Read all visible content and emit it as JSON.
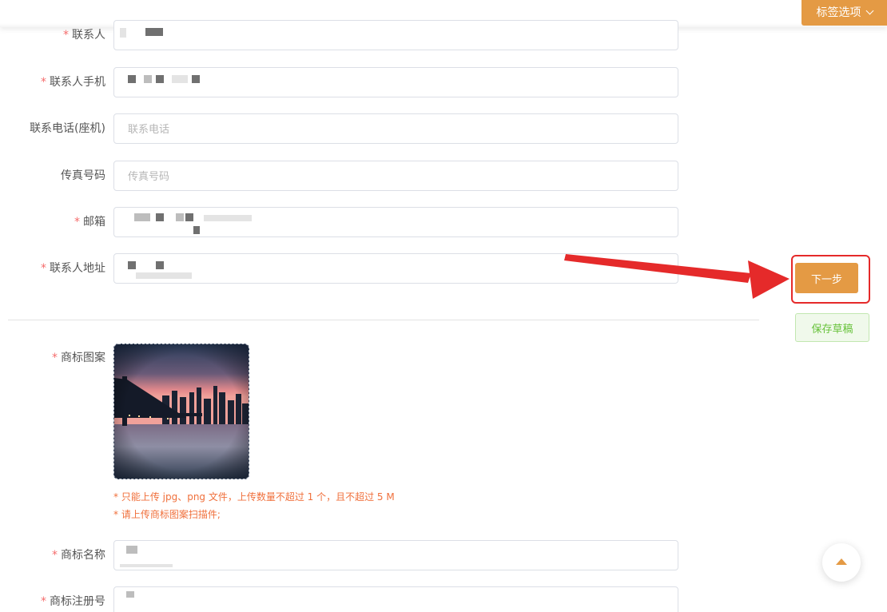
{
  "header": {
    "tag_options_label": "标签选项"
  },
  "form": {
    "contact": {
      "label": "联系人",
      "required": "*",
      "value": ""
    },
    "contact_mobile": {
      "label": "联系人手机",
      "required": "*",
      "value": ""
    },
    "landline": {
      "label": "联系电话(座机)",
      "placeholder": "联系电话",
      "value": ""
    },
    "fax": {
      "label": "传真号码",
      "placeholder": "传真号码",
      "value": ""
    },
    "email": {
      "label": "邮箱",
      "required": "*",
      "value": ""
    },
    "address": {
      "label": "联系人地址",
      "required": "*",
      "value": ""
    },
    "trademark_image": {
      "label": "商标图案",
      "required": "*",
      "tip1": "* 只能上传 jpg、png 文件，上传数量不超过 1 个，且不超过 5 M",
      "tip2": "* 请上传商标图案扫描件;"
    },
    "trademark_name": {
      "label": "商标名称",
      "required": "*",
      "value": ""
    },
    "trademark_reg_no": {
      "label": "商标注册号",
      "required": "*",
      "value": ""
    }
  },
  "actions": {
    "next_label": "下一步",
    "save_draft_label": "保存草稿"
  },
  "icons": {
    "tag_options": "chevron-down-icon",
    "scroll_top": "caret-up-icon",
    "annotation": "red-arrow-icon"
  },
  "colors": {
    "accent": "#e49a44",
    "required": "#f56c6c",
    "tip": "#f0703c",
    "draft": "#67c23a",
    "highlight": "#e52a2a"
  }
}
